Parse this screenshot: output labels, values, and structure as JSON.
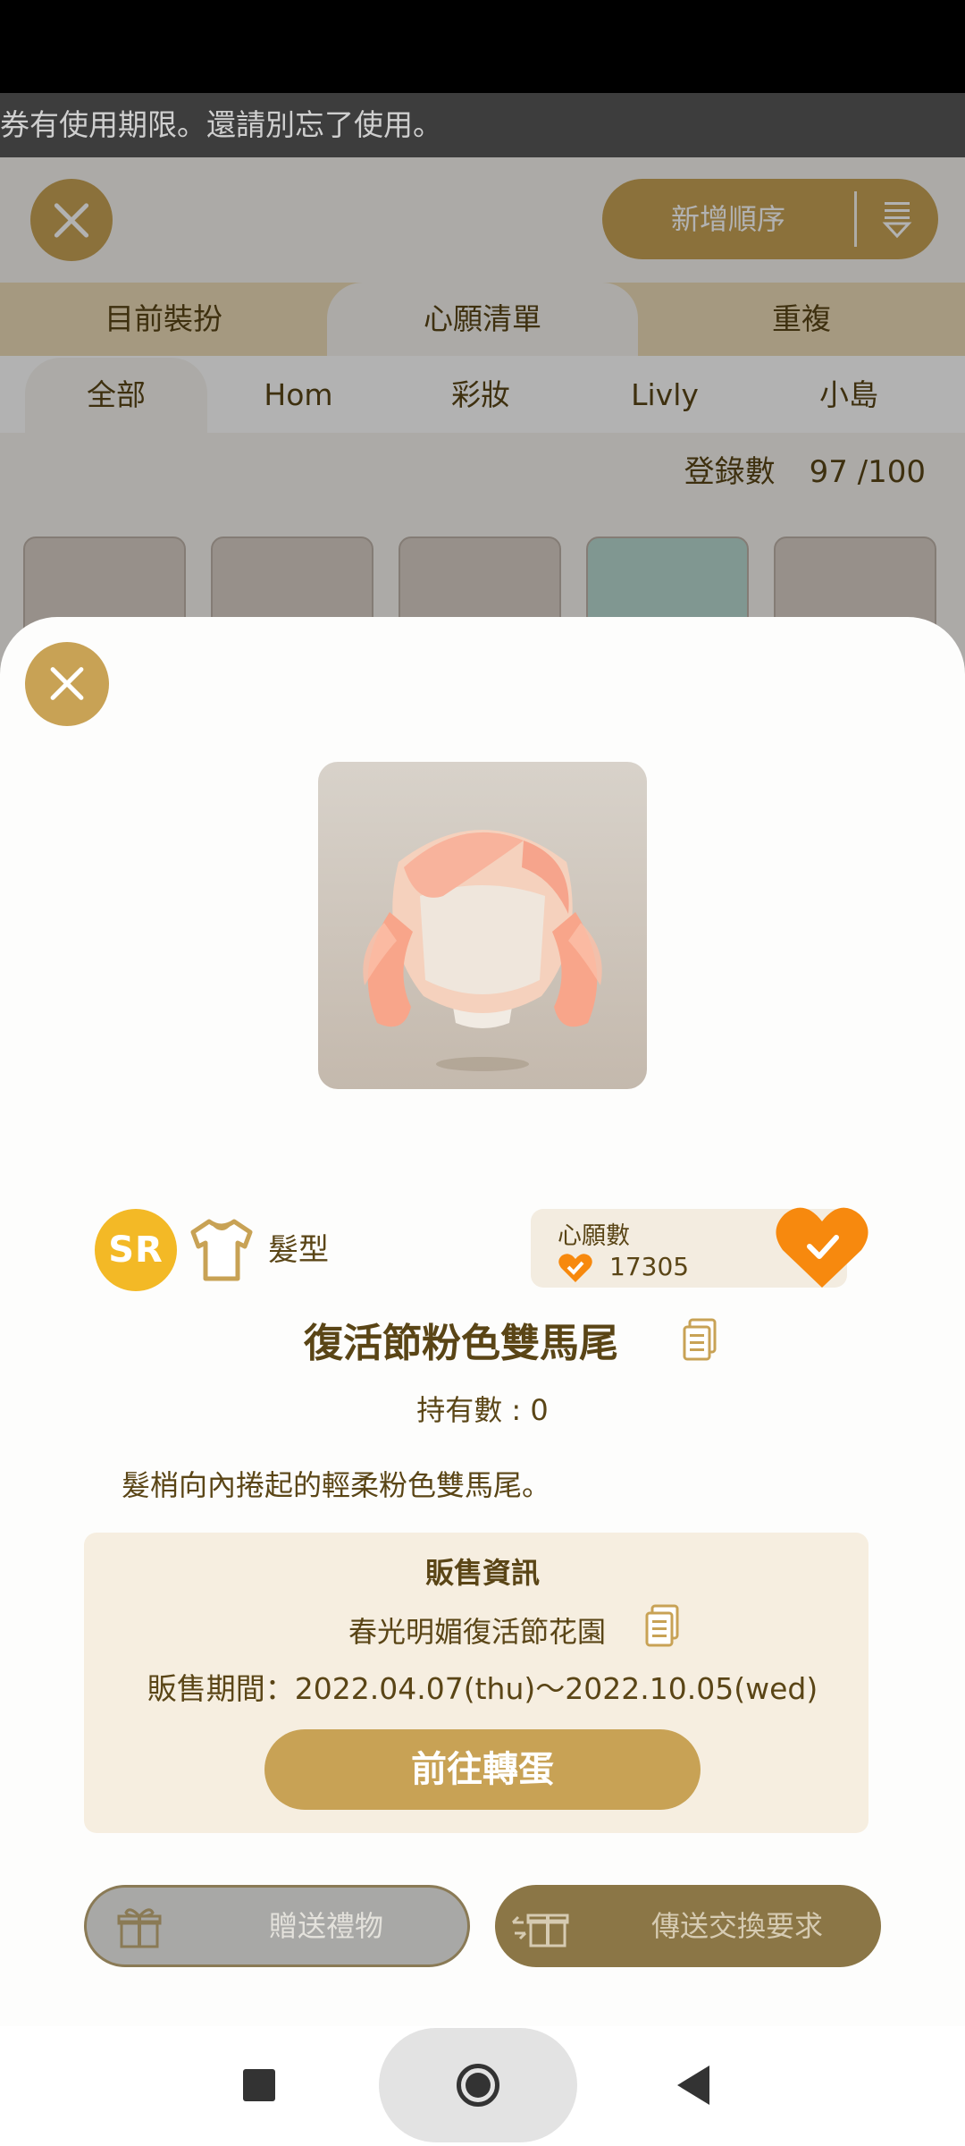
{
  "notice": {
    "text": "券有使用期限。還請別忘了使用。"
  },
  "header": {
    "sort_label": "新增順序"
  },
  "tabs": [
    {
      "label": "目前裝扮",
      "active": false
    },
    {
      "label": "心願清單",
      "active": true
    },
    {
      "label": "重複",
      "active": false
    }
  ],
  "subtabs": [
    {
      "label": "全部",
      "active": true
    },
    {
      "label": "Hom",
      "active": false
    },
    {
      "label": "彩妝",
      "active": false
    },
    {
      "label": "Livly",
      "active": false
    },
    {
      "label": "小島",
      "active": false
    }
  ],
  "registration": {
    "label": "登錄數",
    "value": "97 /100"
  },
  "item": {
    "rarity": "SR",
    "category": "髮型",
    "wishlist_label": "心願數",
    "wishlist_count": "17305",
    "name": "復活節粉色雙馬尾",
    "owned": "持有數 : 0",
    "description": "髮梢向內捲起的輕柔粉色雙馬尾。"
  },
  "sale": {
    "title": "販售資訊",
    "event": "春光明媚復活節花園",
    "period": "販售期間：2022.04.07(thu)〜2022.10.05(wed)",
    "gacha_button": "前往轉蛋"
  },
  "actions": {
    "gift_label": "贈送禮物",
    "trade_label": "傳送交換要求"
  },
  "icons": {
    "close": "close-icon",
    "sort": "sort-icon",
    "shirt": "shirt-icon",
    "heart": "heart-check-icon",
    "document": "document-icon",
    "gift": "gift-icon",
    "trade": "trade-icon"
  },
  "colors": {
    "accent": "#c8a255",
    "heart": "#f7890e",
    "rarity": "#f3b926",
    "text": "#5a4516"
  }
}
